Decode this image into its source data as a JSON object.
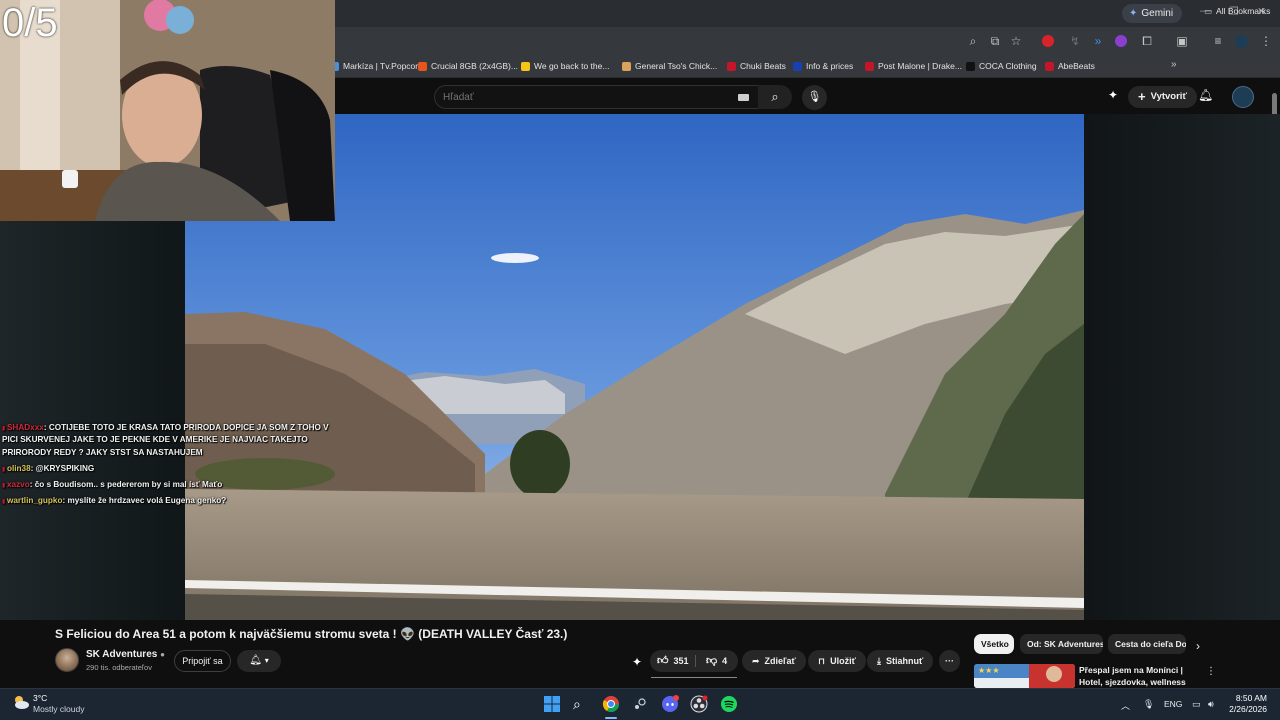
{
  "browser": {
    "gemini_label": "Gemini",
    "bookmarks": [
      {
        "label": "Markíza | Tv.Popcor...",
        "color": "#4a90d9"
      },
      {
        "label": "Crucial 8GB (2x4GB)...",
        "color": "#e8541e"
      },
      {
        "label": "We go back to the...",
        "color": "#f5c518"
      },
      {
        "label": "General Tso's Chick...",
        "color": "#d9a35b"
      },
      {
        "label": "Chuki Beats",
        "color": "#c4162a"
      },
      {
        "label": "Info & prices",
        "color": "#1a3fb0"
      },
      {
        "label": "Post Malone | Drake...",
        "color": "#c4162a"
      },
      {
        "label": "COCA Clothing",
        "color": "#111111"
      },
      {
        "label": "AbeBeats",
        "color": "#c4162a"
      }
    ],
    "bookmarks_more": "»",
    "all_bookmarks": "All Bookmarks"
  },
  "youtube": {
    "search_placeholder": "Hľadať",
    "create_label": "Vytvoriť"
  },
  "stream": {
    "counter": "0/5",
    "chat": [
      {
        "user": "SHADxxx",
        "user_color": "red",
        "text": ": COTIJEBE TOTO JE KRASA TATO PRIRODA DOPICE JA SOM Z TOHO V"
      },
      {
        "user": "",
        "user_color": "none",
        "text": "PICI SKURVENEJ JAKE TO JE PEKNE KDE V AMERIKE JE NAJVIAC TAKEJTO"
      },
      {
        "user": "",
        "user_color": "none",
        "text": "PRIRORODY REDY ? JAKY STST     SA NASTAHUJEM"
      },
      {
        "user": "olin38",
        "user_color": "yellow",
        "text": ": @KRYSPIKING"
      },
      {
        "user": "xazvo",
        "user_color": "red",
        "text": ": čo s Boudisom.. s pedererom by si mal ísť Maťo"
      },
      {
        "user": "wartlin_gupko",
        "user_color": "yellow",
        "text": ": myslíte že hrdzavec volá Eugena genko?"
      }
    ]
  },
  "video": {
    "title": "S Feliciou do Area 51 a potom k najväčšiemu stromu sveta ! 👽 (DEATH VALLEY Časť 23.)",
    "channel_name": "SK Adventures",
    "subscribers": "290 tis. odberateľov",
    "join_label": "Pripojiť sa",
    "likes": "351",
    "dislikes": "4",
    "share_label": "Zdieľať",
    "save_label": "Uložiť",
    "download_label": "Stiahnuť",
    "more_label": "···"
  },
  "sidebar": {
    "chips": [
      "Všetko",
      "Od: SK Adventures",
      "Cesta do cieľa Do"
    ],
    "recommended_title": "Přespal jsem na Monínci | Hotel, sjezdovka, wellness"
  },
  "taskbar": {
    "temperature": "3°C",
    "weather": "Mostly cloudy",
    "language": "ENG",
    "time": "8:50 AM",
    "date": "2/26/2026"
  }
}
